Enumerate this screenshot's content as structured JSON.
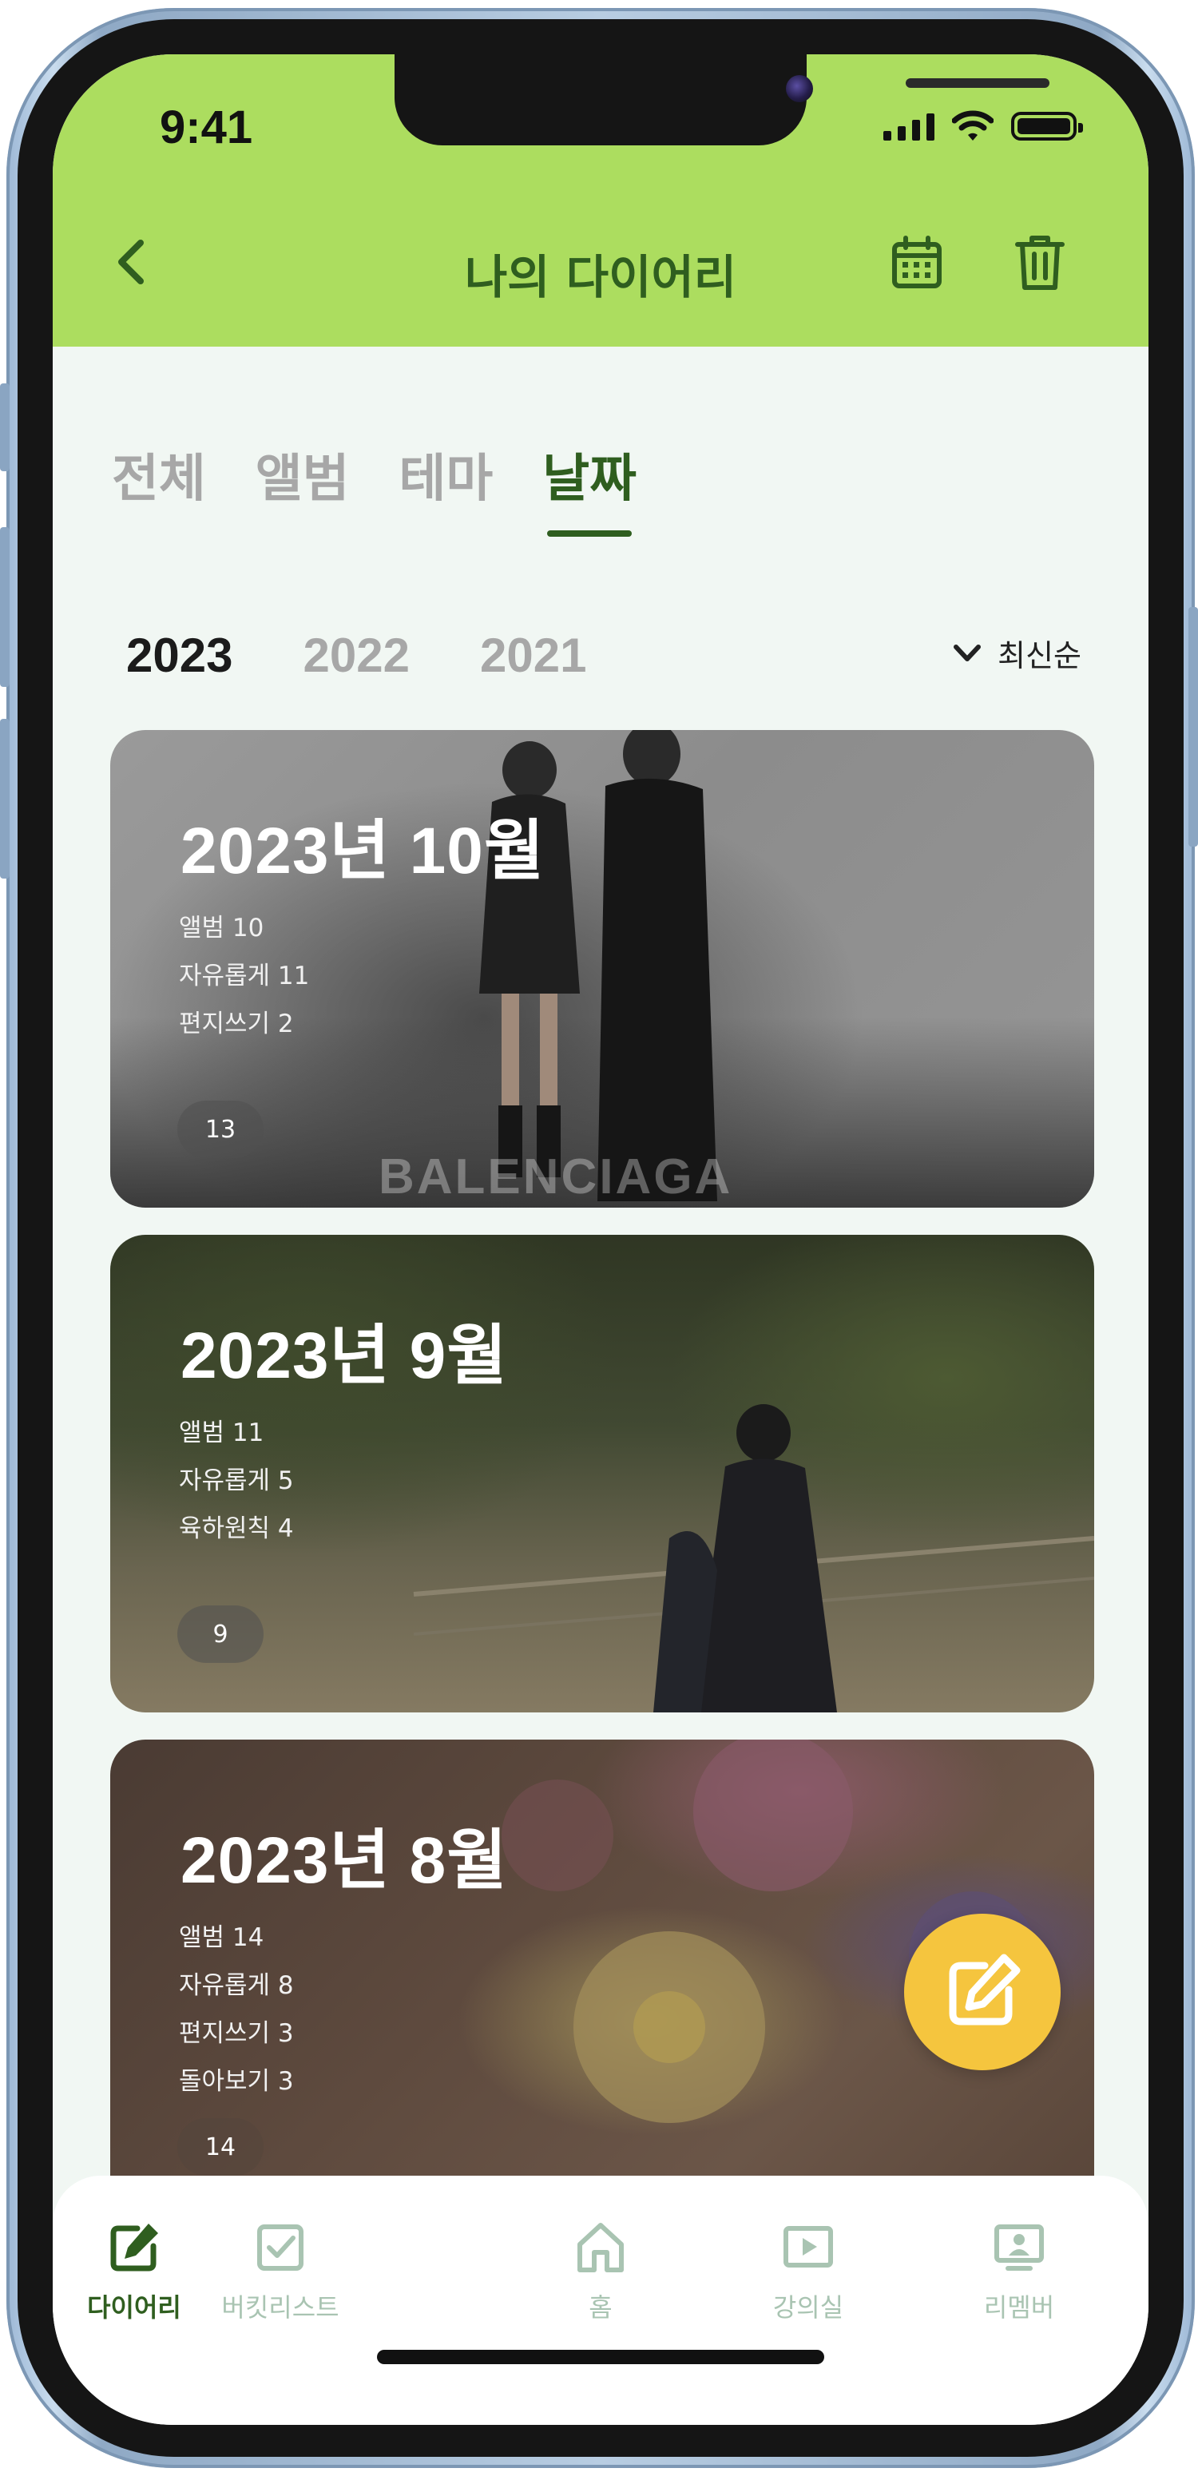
{
  "status_bar": {
    "time": "9:41"
  },
  "header": {
    "title": "나의 다이어리",
    "icons": [
      "back-icon",
      "calendar-icon",
      "trash-icon"
    ]
  },
  "tabs": [
    {
      "label": "전체",
      "active": false
    },
    {
      "label": "앨범",
      "active": false
    },
    {
      "label": "테마",
      "active": false
    },
    {
      "label": "날짜",
      "active": true
    }
  ],
  "years": [
    {
      "label": "2023",
      "active": true
    },
    {
      "label": "2022",
      "active": false
    },
    {
      "label": "2021",
      "active": false
    }
  ],
  "sort": {
    "label": "최신순"
  },
  "cards": [
    {
      "title": "2023년 10월",
      "stats": [
        "앨범 10",
        "자유롭게 11",
        "편지쓰기 2"
      ],
      "count": "13",
      "watermark": "BALENCIAGA"
    },
    {
      "title": "2023년 9월",
      "stats": [
        "앨범 11",
        "자유롭게 5",
        "육하원칙 4"
      ],
      "count": "9"
    },
    {
      "title": "2023년 8월",
      "stats": [
        "앨범 14",
        "자유롭게 8",
        "편지쓰기 3",
        "돌아보기 3"
      ],
      "count": "14"
    }
  ],
  "fab": {
    "icon": "edit-icon"
  },
  "bottom_nav": [
    {
      "label": "다이어리",
      "icon": "diary-edit-icon",
      "active": true
    },
    {
      "label": "버킷리스트",
      "icon": "checkbox-icon",
      "active": false
    },
    {
      "label": "홈",
      "icon": "home-icon",
      "active": false
    },
    {
      "label": "강의실",
      "icon": "play-icon",
      "active": false
    },
    {
      "label": "리멤버",
      "icon": "monitor-person-icon",
      "active": false
    }
  ],
  "colors": {
    "header_bg": "#acdd5f",
    "accent_dark_green": "#2f5e1f",
    "screen_bg": "#f1f7f3",
    "fab": "#f5c53e",
    "inactive_text": "#a7a7a7"
  }
}
